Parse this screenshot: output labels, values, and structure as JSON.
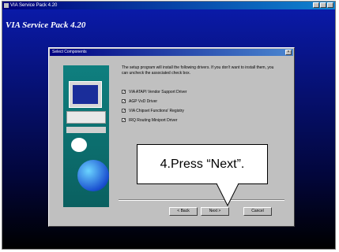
{
  "window": {
    "title": "VIA Service Pack 4.20",
    "product_heading": "VIA Service Pack 4.20"
  },
  "dialog": {
    "title": "Select Components",
    "intro": "The setup program will install the following drivers. If you don't want to install them, you can uncheck the associated check box.",
    "options": [
      {
        "label": "VIA ATAPI Vendor Support Driver",
        "checked": true
      },
      {
        "label": "AGP VxD Driver",
        "checked": true
      },
      {
        "label": "VIA Chipset Functions' Registry",
        "checked": true
      },
      {
        "label": "IRQ Routing Miniport Driver",
        "checked": true
      }
    ],
    "buttons": {
      "back": "< Back",
      "next": "Next >",
      "cancel": "Cancel"
    }
  },
  "callout": {
    "text": "4.Press “Next”."
  }
}
